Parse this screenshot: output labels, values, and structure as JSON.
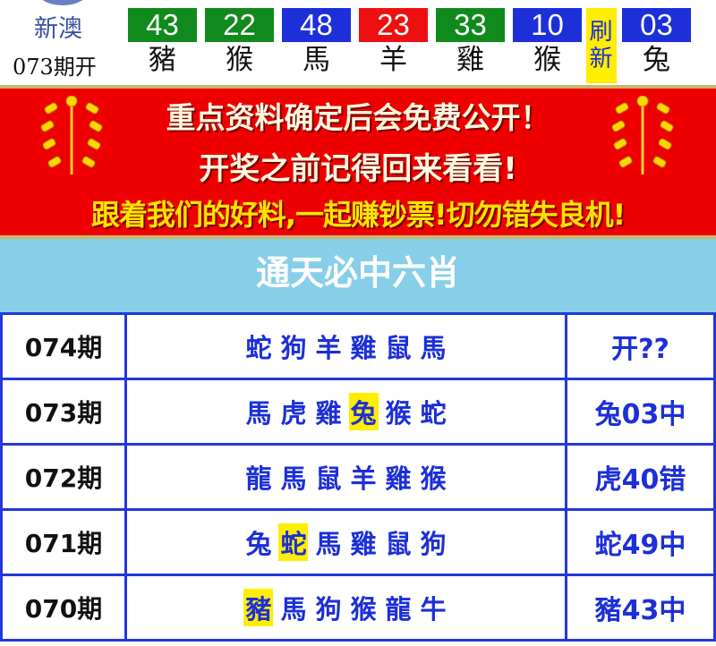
{
  "header": {
    "site_name": "新澳",
    "issue_label": "073期开",
    "balls": [
      {
        "number": "43",
        "zodiac": "豬",
        "color": "#108a1c"
      },
      {
        "number": "22",
        "zodiac": "猴",
        "color": "#108a1c"
      },
      {
        "number": "48",
        "zodiac": "馬",
        "color": "#1c2fd8"
      },
      {
        "number": "23",
        "zodiac": "羊",
        "color": "#ee1010"
      },
      {
        "number": "33",
        "zodiac": "雞",
        "color": "#108a1c"
      },
      {
        "number": "10",
        "zodiac": "猴",
        "color": "#1c2fd8"
      }
    ],
    "refresh_label": "刷新",
    "special_ball": {
      "number": "03",
      "zodiac": "兔",
      "color": "#1c2fd8"
    }
  },
  "banner": {
    "line1": "重点资料确定后会免费公开！",
    "line2": "开奖之前记得回来看看!",
    "line3": "跟着我们的好料,一起赚钞票!切勿错失良机!"
  },
  "title": "通天必中六肖",
  "rows": [
    {
      "period": "074期",
      "animals": [
        "蛇",
        "狗",
        "羊",
        "雞",
        "鼠",
        "馬"
      ],
      "hit": -1,
      "result": "开??"
    },
    {
      "period": "073期",
      "animals": [
        "馬",
        "虎",
        "雞",
        "兔",
        "猴",
        "蛇"
      ],
      "hit": 3,
      "result": "兔03中"
    },
    {
      "period": "072期",
      "animals": [
        "龍",
        "馬",
        "鼠",
        "羊",
        "雞",
        "猴"
      ],
      "hit": -1,
      "result": "虎40错"
    },
    {
      "period": "071期",
      "animals": [
        "兔",
        "蛇",
        "馬",
        "雞",
        "鼠",
        "狗"
      ],
      "hit": 1,
      "result": "蛇49中"
    },
    {
      "period": "070期",
      "animals": [
        "豬",
        "馬",
        "狗",
        "猴",
        "龍",
        "牛"
      ],
      "hit": 0,
      "result": "豬43中"
    }
  ],
  "colors": {
    "accent_blue": "#1c2fd8",
    "banner_red": "#ee0000",
    "title_bg": "#87cee9",
    "highlight": "#ffee00"
  }
}
